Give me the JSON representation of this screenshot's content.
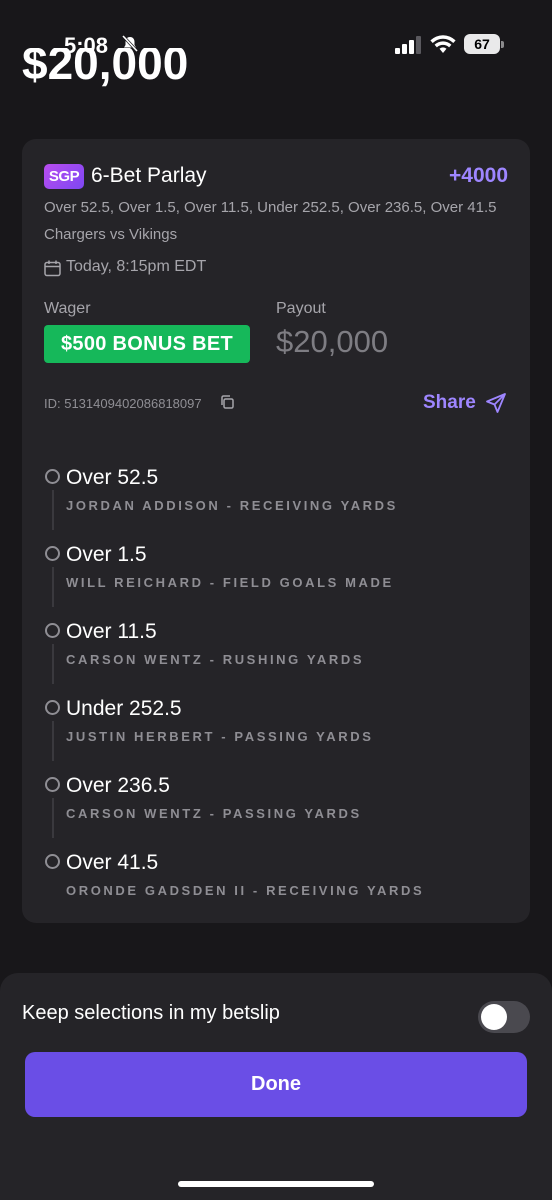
{
  "status_bar": {
    "time": "5:08",
    "battery": "67"
  },
  "header": {
    "payout_amount": "$20,000"
  },
  "card": {
    "badge": "SGP",
    "title": "6-Bet Parlay",
    "odds": "+4000",
    "selections_summary": "Over 52.5, Over 1.5, Over 11.5, Under 252.5, Over 236.5, Over 41.5",
    "matchup": "Chargers vs Vikings",
    "game_time": "Today, 8:15pm EDT",
    "wager_label": "Wager",
    "wager_value": "$500 BONUS BET",
    "payout_label": "Payout",
    "payout_value": "$20,000",
    "bet_id": "ID: 5131409402086818097",
    "share_label": "Share",
    "legs": [
      {
        "selection": "Over 52.5",
        "market": "JORDAN ADDISON - RECEIVING YARDS"
      },
      {
        "selection": "Over 1.5",
        "market": "WILL REICHARD - FIELD GOALS MADE"
      },
      {
        "selection": "Over 11.5",
        "market": "CARSON WENTZ - RUSHING YARDS"
      },
      {
        "selection": "Under 252.5",
        "market": "JUSTIN HERBERT - PASSING YARDS"
      },
      {
        "selection": "Over 236.5",
        "market": "CARSON WENTZ - PASSING YARDS"
      },
      {
        "selection": "Over 41.5",
        "market": "ORONDE GADSDEN II - RECEIVING YARDS"
      }
    ]
  },
  "sheet": {
    "keep_label": "Keep selections in my betslip",
    "keep_toggle_on": false,
    "done_label": "Done"
  },
  "colors": {
    "accent": "#6a4ee6",
    "odds": "#9e86ff",
    "bonus": "#16b85a"
  }
}
